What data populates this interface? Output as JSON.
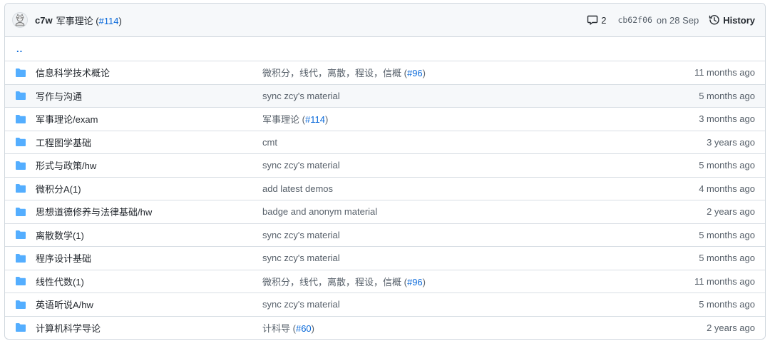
{
  "header": {
    "author": "c7w",
    "message": "军事理论",
    "pr_open": " (",
    "pr_link": "#114",
    "pr_close": ")",
    "comment_count": "2",
    "sha": "cb62f06",
    "date": "on 28 Sep",
    "history_label": "History"
  },
  "parent_dir_label": "..",
  "rows": [
    {
      "name": "信息科学技术概论",
      "message": "微积分，线代，离散，程设，信概",
      "pr": "#96",
      "age": "11 months ago"
    },
    {
      "name": "写作与沟通",
      "message": "sync zcy's material",
      "pr": "",
      "age": "5 months ago"
    },
    {
      "name": "军事理论/exam",
      "message": "军事理论",
      "pr": "#114",
      "age": "3 months ago"
    },
    {
      "name": "工程图学基础",
      "message": "cmt",
      "pr": "",
      "age": "3 years ago"
    },
    {
      "name": "形式与政策/hw",
      "message": "sync zcy's material",
      "pr": "",
      "age": "5 months ago"
    },
    {
      "name": "微积分A(1)",
      "message": "add latest demos",
      "pr": "",
      "age": "4 months ago"
    },
    {
      "name": "思想道德修养与法律基础/hw",
      "message": "badge and anonym material",
      "pr": "",
      "age": "2 years ago"
    },
    {
      "name": "离散数学(1)",
      "message": "sync zcy's material",
      "pr": "",
      "age": "5 months ago"
    },
    {
      "name": "程序设计基础",
      "message": "sync zcy's material",
      "pr": "",
      "age": "5 months ago"
    },
    {
      "name": "线性代数(1)",
      "message": "微积分，线代，离散，程设，信概",
      "pr": "#96",
      "age": "11 months ago"
    },
    {
      "name": "英语听说A/hw",
      "message": "sync zcy's material",
      "pr": "",
      "age": "5 months ago"
    },
    {
      "name": "计算机科学导论",
      "message": "计科导",
      "pr": "#60",
      "age": "2 years ago"
    }
  ],
  "colors": {
    "folder": "#54aeff",
    "link": "#0969da",
    "muted": "#57606a",
    "border": "#d0d7de",
    "header_bg": "#f6f8fa"
  },
  "icons": {
    "folder": "folder-icon",
    "comment": "comment-icon",
    "history": "history-icon",
    "avatar": "avatar"
  }
}
